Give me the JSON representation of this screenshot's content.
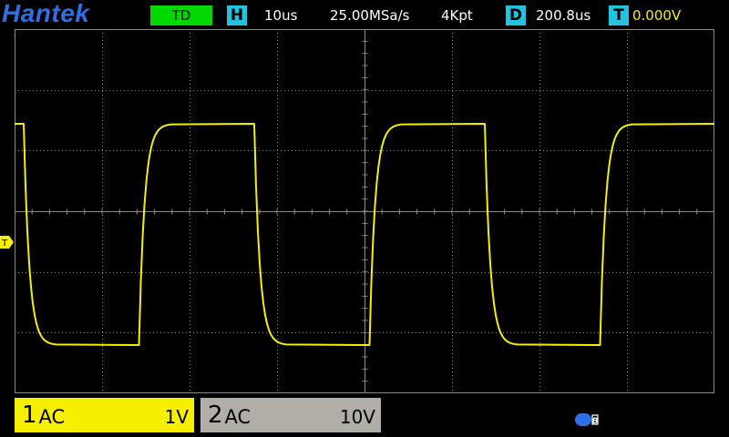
{
  "header": {
    "brand": "Hantek",
    "mode": "TD",
    "h_icon": "H",
    "timebase": "10us",
    "sample_rate": "25.00MSa/s",
    "memory_depth": "4Kpt",
    "d_icon": "D",
    "delay": "200.8us",
    "t_icon": "T",
    "trigger_level": "0.000V"
  },
  "markers": {
    "trigger_marker_label": "T",
    "horizontal_position_icon": "triangle-left-icon",
    "usb_icon": "usb-icon"
  },
  "channels": [
    {
      "number": "1",
      "coupling": "AC",
      "scale": "1V",
      "color": "#f5f000"
    },
    {
      "number": "2",
      "coupling": "AC",
      "scale": "10V",
      "color": "#b0aea7"
    }
  ],
  "colors": {
    "brand": "#2f6fe6",
    "mode_bg": "#00d800",
    "icon_bg": "#23c2df",
    "trace": "#f4f000",
    "grid": "#8a8a8a"
  }
}
